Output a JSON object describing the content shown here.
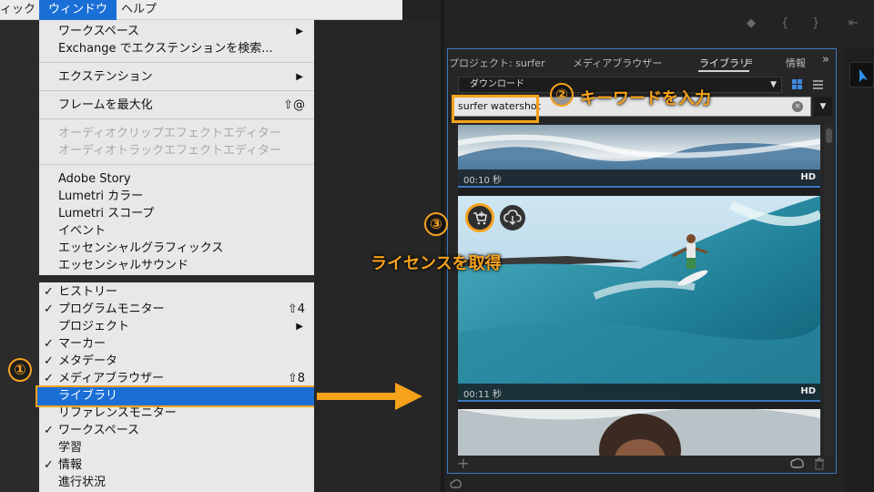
{
  "menubar": {
    "left_item": "ィック",
    "window_menu": "ウィンドウ",
    "help_menu": "ヘルプ"
  },
  "menu_items": [
    {
      "label": "ワークスペース",
      "submenu": true
    },
    {
      "label": "Exchange でエクステンションを検索..."
    },
    {
      "label": "エクステンション",
      "submenu": true
    },
    {
      "label": "フレームを最大化",
      "shortcut": "⇧@"
    },
    {
      "label": "オーディオクリップエフェクトエディター",
      "disabled": true
    },
    {
      "label": "オーディオトラックエフェクトエディター",
      "disabled": true
    },
    {
      "label": "Adobe Story"
    },
    {
      "label": "Lumetri カラー"
    },
    {
      "label": "Lumetri スコープ"
    },
    {
      "label": "イベント"
    },
    {
      "label": "エッセンシャルグラフィックス"
    },
    {
      "label": "エッセンシャルサウンド"
    },
    {
      "label": "ヒストリー",
      "checked": true
    },
    {
      "label": "プログラムモニター",
      "checked": true,
      "shortcut": "⇧4"
    },
    {
      "label": "プロジェクト",
      "submenu": true
    },
    {
      "label": "マーカー",
      "checked": true
    },
    {
      "label": "メタデータ",
      "checked": true
    },
    {
      "label": "メディアブラウザー",
      "checked": true,
      "shortcut": "⇧8"
    },
    {
      "label": "ライブラリ",
      "highlighted": true
    },
    {
      "label": "リファレンスモニター"
    },
    {
      "label": "ワークスペース",
      "checked": true
    },
    {
      "label": "学習"
    },
    {
      "label": "情報",
      "checked": true
    },
    {
      "label": "進行状況"
    }
  ],
  "check_glyph": "✓",
  "submenu_glyph": "▶",
  "panel": {
    "tabs": [
      "プロジェクト: surfer",
      "メディアブラウザー",
      "ライブラリ",
      "情報"
    ],
    "tab_menu_glyph": "≡",
    "overflow_glyph": "»",
    "library_select": "ダウンロード",
    "search_value": "surfer watershot",
    "clear_glyph": "✕",
    "dropdown_glyph": "▼",
    "add_glyph": "+"
  },
  "clips": [
    {
      "duration": "00:10 秒",
      "quality": "HD"
    },
    {
      "duration": "00:11 秒",
      "quality": "HD"
    }
  ],
  "annotations": {
    "step1": "①",
    "step2_num": "②",
    "step2_text": "キーワードを入力",
    "step3_num": "③",
    "step3_text": "ライセンスを取得"
  },
  "colors": {
    "accent_orange": "#f7a21b",
    "selection_blue": "#1a6fd6",
    "panel_border": "#3d77c2"
  }
}
